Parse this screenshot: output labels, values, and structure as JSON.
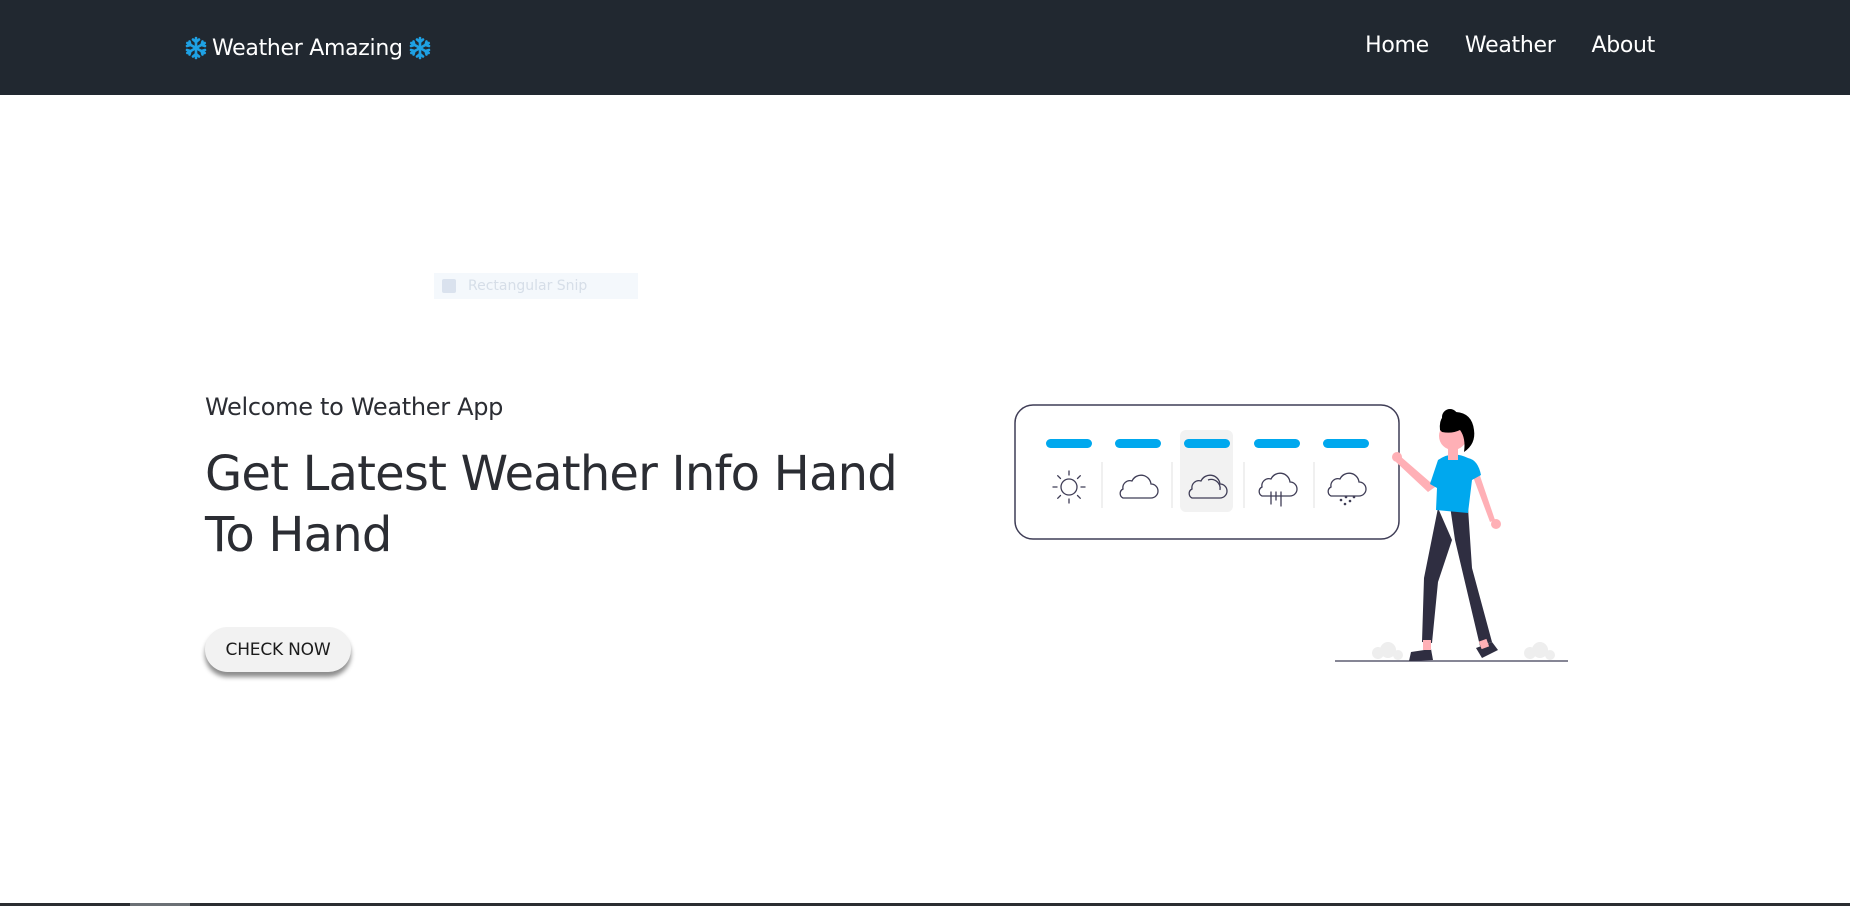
{
  "navbar": {
    "brand": "Weather Amazing",
    "links": [
      {
        "label": "Home"
      },
      {
        "label": "Weather"
      },
      {
        "label": "About"
      }
    ]
  },
  "hero": {
    "welcome": "Welcome to Weather App",
    "headline_line1": "Get Latest Weather Info Hand",
    "headline_line2": "To Hand",
    "cta_label": "CHECK NOW"
  },
  "overlay": {
    "snip_label": "Rectangular Snip"
  },
  "illustration": {
    "icons": [
      "sun-icon",
      "cloud-icon",
      "partly-cloudy-icon",
      "rain-icon",
      "snow-icon"
    ],
    "selected_index": 2,
    "colors": {
      "accent": "#00a8ee",
      "figure_shirt": "#00a8ee",
      "figure_pants": "#2f2e41",
      "skin": "#ffb0b6",
      "outline": "#3f3d56"
    }
  },
  "colors": {
    "navbar_bg": "#212830",
    "brand_icon": "#1ea1e4"
  }
}
